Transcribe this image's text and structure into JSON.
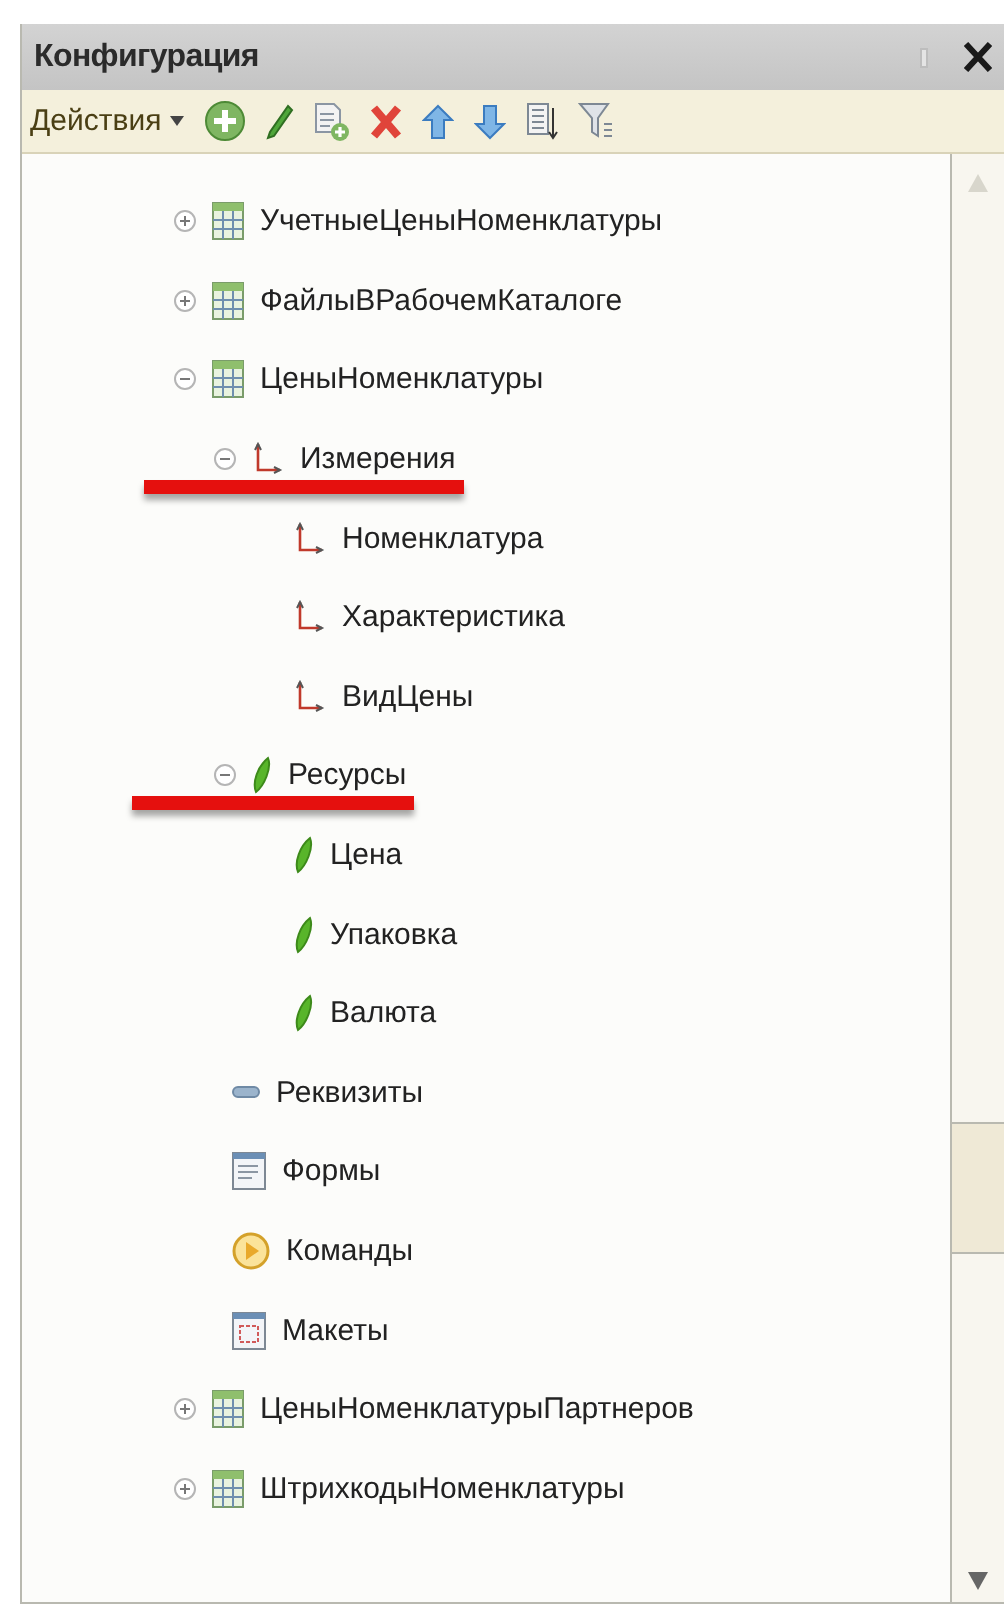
{
  "window": {
    "title": "Конфигурация"
  },
  "toolbar": {
    "actions_label": "Действия"
  },
  "tree": [
    {
      "label": "УчетныеЦеныНоменклатуры",
      "kind": "table",
      "expanded": false,
      "highlighted": false
    },
    {
      "label": "ФайлыВРабочемКаталоге",
      "kind": "table",
      "expanded": false,
      "highlighted": false
    },
    {
      "label": "ЦеныНоменклатуры",
      "kind": "table",
      "expanded": true,
      "highlighted": false,
      "children": [
        {
          "label": "Измерения",
          "kind": "dimension",
          "expanded": true,
          "highlighted": true,
          "children": [
            {
              "label": "Номенклатура",
              "kind": "dimension",
              "highlighted": false
            },
            {
              "label": "Характеристика",
              "kind": "dimension",
              "highlighted": false
            },
            {
              "label": "ВидЦены",
              "kind": "dimension",
              "highlighted": false
            }
          ]
        },
        {
          "label": "Ресурсы",
          "kind": "resource",
          "expanded": true,
          "highlighted": true,
          "children": [
            {
              "label": "Цена",
              "kind": "resource",
              "highlighted": false
            },
            {
              "label": "Упаковка",
              "kind": "resource",
              "highlighted": false
            },
            {
              "label": "Валюта",
              "kind": "resource",
              "highlighted": false
            }
          ]
        },
        {
          "label": "Реквизиты",
          "kind": "attribute",
          "highlighted": false
        },
        {
          "label": "Формы",
          "kind": "form",
          "highlighted": false
        },
        {
          "label": "Команды",
          "kind": "command",
          "highlighted": false
        },
        {
          "label": "Макеты",
          "kind": "template",
          "highlighted": false
        }
      ]
    },
    {
      "label": "ЦеныНоменклатурыПартнеров",
      "kind": "table",
      "expanded": false,
      "highlighted": false
    },
    {
      "label": "ШтрихкодыНоменклатуры",
      "kind": "table",
      "expanded": false,
      "highlighted": false
    }
  ]
}
